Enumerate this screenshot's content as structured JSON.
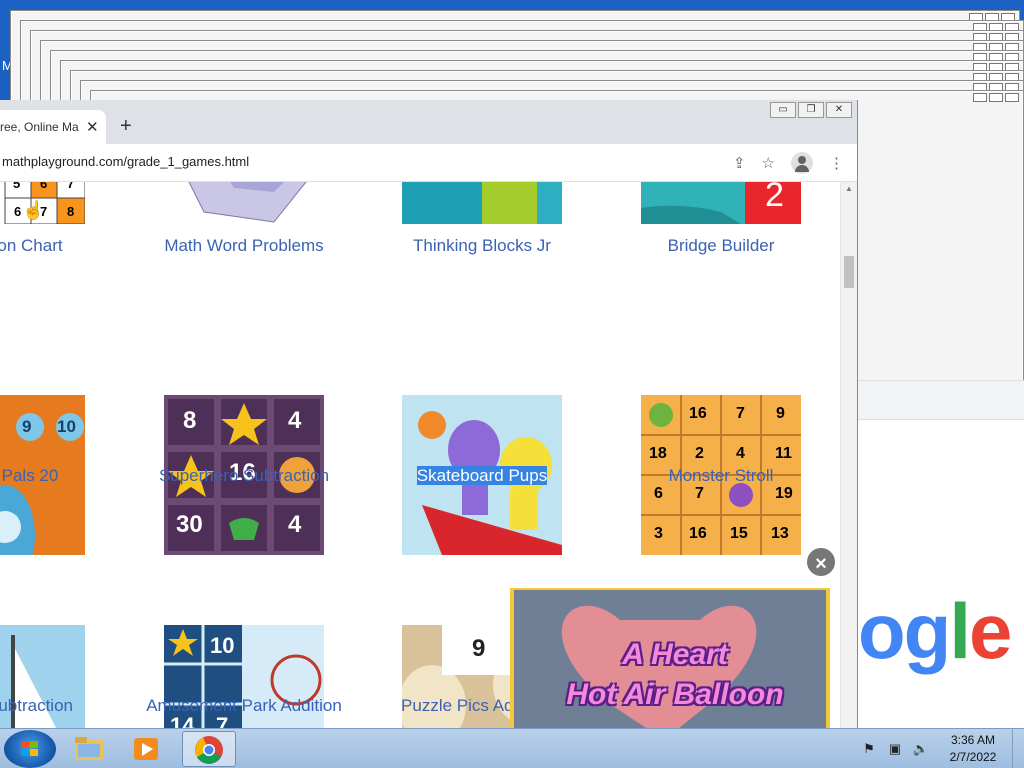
{
  "desktop": {
    "label": "M"
  },
  "right_window": {
    "brand_fragment": [
      "o",
      "g",
      "l",
      "e"
    ]
  },
  "browser": {
    "tab_title": "ree, Online Ma",
    "tab_close": "✕",
    "new_tab": "+",
    "url": "mathplayground.com/grade_1_games.html",
    "window_buttons": [
      "▭",
      "❐",
      "✕"
    ]
  },
  "games": [
    {
      "label": "on Chart",
      "thumb_text": [
        "5",
        "6",
        "7",
        "6",
        "7",
        "8"
      ]
    },
    {
      "label": "Math Word Problems"
    },
    {
      "label": "Thinking Blocks Jr"
    },
    {
      "label": "Bridge Builder",
      "thumb_text": [
        "2"
      ]
    },
    {
      "label": "Pals 20",
      "thumb_text": [
        "9",
        "10"
      ]
    },
    {
      "label": "Superhero Subtraction",
      "thumb_text": [
        "8",
        "4",
        "16",
        "30",
        "4"
      ]
    },
    {
      "label": "Skateboard Pups",
      "selected": true
    },
    {
      "label": "Monster Stroll",
      "thumb_text": [
        "16",
        "7",
        "9",
        "18",
        "2",
        "4",
        "11",
        "6",
        "7",
        "19",
        "3",
        "16",
        "15",
        "13"
      ]
    },
    {
      "label": "Subtraction"
    },
    {
      "label": "Amusement Park Addition",
      "thumb_text": [
        "10",
        "14",
        "7"
      ]
    },
    {
      "label": "Puzzle Pics Add",
      "thumb_text": [
        "9"
      ]
    },
    {
      "label": ""
    }
  ],
  "ad": {
    "line1": "A Heart",
    "line2": "Hot Air Balloon",
    "close": "×"
  },
  "taskbar": {
    "time": "3:36 AM",
    "date": "2/7/2022",
    "apps": [
      "folder-icon",
      "media-player-icon",
      "chrome-icon"
    ]
  },
  "colors": {
    "link": "#3b62b3",
    "selection": "#3584e4",
    "taskbar": "#b9d1ea"
  }
}
